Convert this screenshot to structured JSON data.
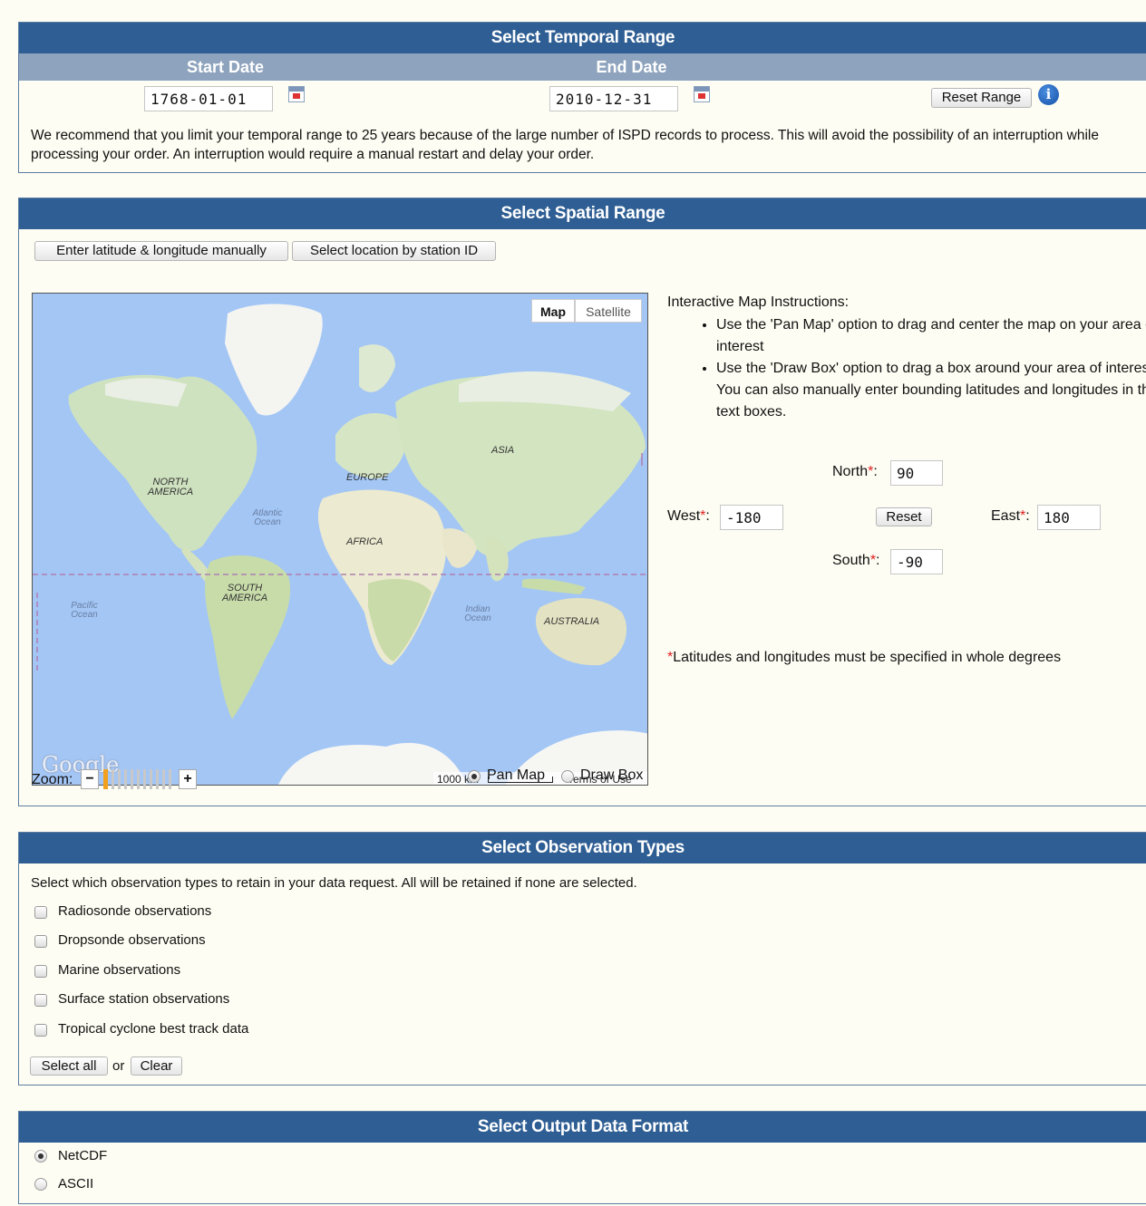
{
  "temporal": {
    "title": "Select Temporal Range",
    "start_header": "Start Date",
    "end_header": "End Date",
    "start_value": "1768-01-01",
    "end_value": "2010-12-31",
    "reset_label": "Reset Range",
    "note": "We recommend that you limit your temporal range to 25 years because of the large number of ISPD records to process. This will avoid the possibility of an interruption while processing your order. An interruption would require a manual restart and delay your order."
  },
  "spatial": {
    "title": "Select Spatial Range",
    "manual_button": "Enter latitude & longitude manually",
    "station_button": "Select location by station ID",
    "map": {
      "type_map": "Map",
      "type_satellite": "Satellite",
      "labels": {
        "north_america": "NORTH\nAMERICA",
        "europe": "EUROPE",
        "asia": "ASIA",
        "africa": "AFRICA",
        "south_america": "SOUTH\nAMERICA",
        "australia": "AUSTRALIA",
        "atlantic": "Atlantic\nOcean",
        "pacific": "Pacific\nOcean",
        "indian": "Indian\nOcean"
      },
      "logo": "Google",
      "scale": "1000 km",
      "terms": "Terms of Use"
    },
    "zoom_label": "Zoom:",
    "zoom_minus": "−",
    "zoom_plus": "+",
    "pan_label": "Pan Map",
    "draw_label": "Draw Box",
    "mode_selected": "Pan Map",
    "instructions_title": "Interactive Map Instructions:",
    "instructions": [
      "Use the 'Pan Map' option to drag and center the map on your area of interest",
      "Use the 'Draw Box' option to drag a box around your area of interest. You can also manually enter bounding latitudes and longitudes in the text boxes."
    ],
    "north_label": "North",
    "south_label": "South",
    "west_label": "West",
    "east_label": "East",
    "required_mark": "*",
    "colon": ":",
    "north_value": "90",
    "south_value": "-90",
    "west_value": "-180",
    "east_value": "180",
    "reset_label": "Reset",
    "whole_degrees_note": "Latitudes and longitudes must be specified in whole degrees"
  },
  "observation": {
    "title": "Select Observation Types",
    "intro": "Select which observation types to retain in your data request. All will be retained if none are selected.",
    "types": [
      "Radiosonde observations",
      "Dropsonde observations",
      "Marine observations",
      "Surface station observations",
      "Tropical cyclone best track data"
    ],
    "select_all": "Select all",
    "or": "or",
    "clear": "Clear"
  },
  "output": {
    "title": "Select Output Data Format",
    "formats": [
      "NetCDF",
      "ASCII"
    ],
    "selected": "NetCDF"
  },
  "colors": {
    "title_bar": "#2e5e93",
    "subheader": "#8ea3bd",
    "page_bg": "#fdfdf3",
    "required": "#e02020"
  }
}
